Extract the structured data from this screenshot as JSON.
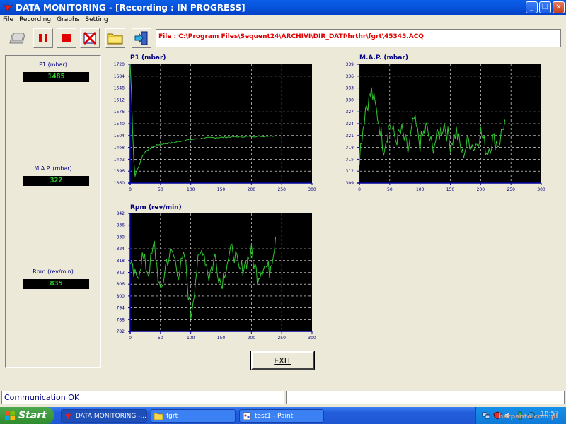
{
  "window": {
    "title": "DATA MONITORING - [Recording : IN PROGRESS]"
  },
  "menu": [
    "File",
    "Recording",
    "Graphs",
    "Setting"
  ],
  "toolbar": {
    "file_path": "File : C:\\Program Files\\Sequent24\\ARCHIVI\\DIR_DATI\\hrthr\\fgrt\\45345.ACQ"
  },
  "gauges": [
    {
      "label": "P1 (mbar)",
      "value": "1485"
    },
    {
      "label": "M.A.P. (mbar)",
      "value": "322"
    },
    {
      "label": "Rpm (rev/min)",
      "value": "835"
    }
  ],
  "charts": [
    {
      "title": "P1 (mbar)",
      "x_ticks": [
        "0",
        "50",
        "100",
        "150",
        "200",
        "250",
        "300"
      ],
      "y_ticks": [
        "1720",
        "1684",
        "1648",
        "1612",
        "1576",
        "1540",
        "1504",
        "1468",
        "1432",
        "1396",
        "1360"
      ]
    },
    {
      "title": "M.A.P. (mbar)",
      "x_ticks": [
        "0",
        "50",
        "100",
        "150",
        "200",
        "250",
        "300"
      ],
      "y_ticks": [
        "339",
        "336",
        "333",
        "330",
        "327",
        "324",
        "321",
        "318",
        "315",
        "312",
        "309"
      ]
    },
    {
      "title": "Rpm (rev/min)",
      "x_ticks": [
        "0",
        "50",
        "100",
        "150",
        "200",
        "250",
        "300"
      ],
      "y_ticks": [
        "842",
        "836",
        "830",
        "824",
        "818",
        "812",
        "806",
        "800",
        "794",
        "788",
        "782"
      ]
    }
  ],
  "exit_button": {
    "label": "EXIT"
  },
  "status": {
    "message": "Communication OK"
  },
  "taskbar": {
    "start_label": "Start",
    "items": [
      {
        "label": "DATA MONITORING -...",
        "active": true
      },
      {
        "label": "fgrt",
        "active": false
      },
      {
        "label": "test1 - Paint",
        "active": false
      }
    ],
    "clock": "18:57"
  },
  "watermark": "hatpanto.com.pl",
  "colors": {
    "plot_bg": "#000000",
    "trace": "#32c832",
    "grid": "#ffffff",
    "axis": "#0000a0",
    "label": "#000080"
  },
  "chart_data": [
    {
      "type": "line",
      "title": "P1 (mbar)",
      "x": [
        0,
        2,
        4,
        6,
        8,
        10,
        13,
        16,
        20,
        25,
        30,
        35,
        40,
        50,
        60,
        70,
        80,
        90,
        100,
        110,
        120,
        130,
        140,
        150,
        160,
        170,
        180,
        190,
        200,
        210,
        220,
        230,
        238
      ],
      "y": [
        1720,
        1640,
        1520,
        1430,
        1380,
        1395,
        1405,
        1420,
        1440,
        1455,
        1462,
        1468,
        1472,
        1478,
        1480,
        1482,
        1486,
        1490,
        1492,
        1494,
        1496,
        1497,
        1498,
        1498,
        1499,
        1500,
        1500,
        1501,
        1501,
        1502,
        1502,
        1503,
        1503
      ],
      "xlim": [
        0,
        300
      ],
      "ylim": [
        1360,
        1720
      ],
      "grid": true
    },
    {
      "type": "line",
      "title": "M.A.P. (mbar)",
      "x": [
        0,
        10,
        20,
        30,
        40,
        50,
        60,
        70,
        80,
        90,
        100,
        110,
        120,
        130,
        140,
        150,
        160,
        170,
        180,
        190,
        200,
        210,
        220,
        230,
        240
      ],
      "y": [
        316,
        328,
        332,
        326,
        318,
        324,
        320,
        322,
        317,
        325,
        319,
        323,
        318,
        321,
        324,
        319,
        322,
        316,
        320,
        318,
        322,
        317,
        320,
        319,
        325
      ],
      "xlim": [
        0,
        300
      ],
      "ylim": [
        309,
        339
      ],
      "grid": true
    },
    {
      "type": "line",
      "title": "Rpm (rev/min)",
      "x": [
        0,
        10,
        20,
        30,
        40,
        50,
        60,
        70,
        80,
        90,
        100,
        110,
        120,
        130,
        140,
        150,
        160,
        170,
        180,
        190,
        200,
        210,
        220,
        230,
        240
      ],
      "y": [
        815,
        808,
        820,
        812,
        826,
        800,
        818,
        822,
        812,
        820,
        790,
        814,
        825,
        810,
        820,
        806,
        818,
        824,
        812,
        817,
        822,
        810,
        816,
        813,
        830
      ],
      "xlim": [
        0,
        300
      ],
      "ylim": [
        782,
        842
      ],
      "grid": true
    }
  ]
}
